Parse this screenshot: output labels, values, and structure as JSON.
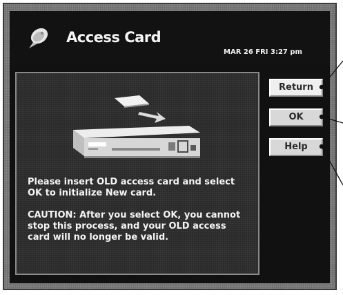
{
  "header": {
    "title": "Access Card",
    "datetime": "MAR 26 FRI  3:27 pm",
    "icon": "satellite-dish-icon"
  },
  "main": {
    "illustration": "receiver-with-card-icon",
    "instruction": "Please insert OLD access card and select OK to initialize New card.",
    "caution": "CAUTION: After you select OK, you cannot stop this process, and your OLD access card will no longer be valid."
  },
  "buttons": {
    "return_label": "Return",
    "ok_label": "OK",
    "help_label": "Help"
  },
  "colors": {
    "frame": "#7b7b7b",
    "screen": "#111111",
    "button_face": "#d8d8d8",
    "text": "#f5f5f5"
  }
}
